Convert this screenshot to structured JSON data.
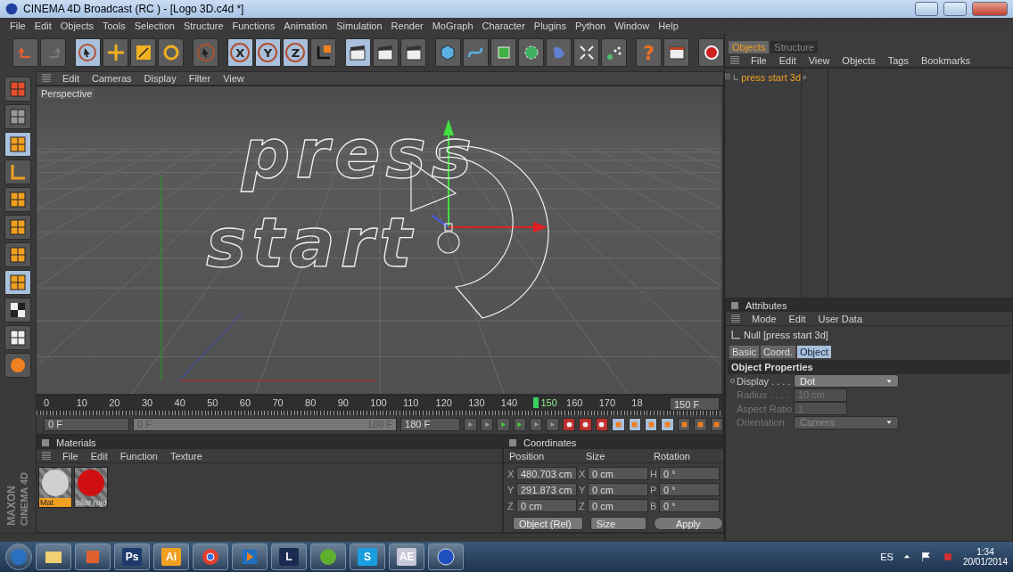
{
  "window": {
    "title": "CINEMA 4D Broadcast (RC ) - [Logo 3D.c4d *]"
  },
  "menu": [
    "File",
    "Edit",
    "Objects",
    "Tools",
    "Selection",
    "Structure",
    "Functions",
    "Animation",
    "Simulation",
    "Render",
    "MoGraph",
    "Character",
    "Plugins",
    "Python",
    "Window",
    "Help"
  ],
  "toolbar": [
    {
      "kind": "undo",
      "selected": false
    },
    {
      "kind": "redo",
      "selected": false
    },
    {
      "kind": "cursor",
      "selected": true
    },
    {
      "kind": "move",
      "selected": false
    },
    {
      "kind": "scale",
      "selected": false
    },
    {
      "kind": "rotate",
      "selected": false
    },
    {
      "kind": "cursor",
      "selected": false
    },
    {
      "kind": "axis",
      "label": "X",
      "selected": true
    },
    {
      "kind": "axis",
      "label": "Y",
      "selected": true
    },
    {
      "kind": "axis",
      "label": "Z",
      "selected": true
    },
    {
      "kind": "coords",
      "selected": false
    },
    {
      "kind": "clapper",
      "selected": true
    },
    {
      "kind": "clapper",
      "selected": false
    },
    {
      "kind": "clapper",
      "selected": false
    },
    {
      "kind": "cube",
      "selected": false
    },
    {
      "kind": "spline",
      "selected": false
    },
    {
      "kind": "nurbs",
      "selected": false
    },
    {
      "kind": "array",
      "selected": false
    },
    {
      "kind": "deformer",
      "selected": false
    },
    {
      "kind": "scene",
      "selected": false
    },
    {
      "kind": "particles",
      "selected": false
    },
    {
      "kind": "help",
      "label": "?",
      "selected": false
    },
    {
      "kind": "render",
      "selected": false
    },
    {
      "kind": "record",
      "selected": false
    }
  ],
  "side_tools": [
    {
      "kind": "layout",
      "selected": false
    },
    {
      "kind": "sculpt",
      "selected": false
    },
    {
      "kind": "model",
      "selected": true
    },
    {
      "kind": "object-axis",
      "selected": false
    },
    {
      "kind": "points",
      "selected": false
    },
    {
      "kind": "edges",
      "selected": false
    },
    {
      "kind": "polygons",
      "selected": false
    },
    {
      "kind": "uv",
      "selected": true
    },
    {
      "kind": "checker",
      "selected": false
    },
    {
      "kind": "workplane",
      "selected": false
    },
    {
      "kind": "snap",
      "selected": false
    }
  ],
  "viewport": {
    "menu": [
      "Edit",
      "Cameras",
      "Display",
      "Filter",
      "View"
    ],
    "camera": "Perspective",
    "logo_lines": [
      "press",
      "start"
    ]
  },
  "timeline": {
    "ticks": [
      {
        "label": "0",
        "selected": false
      },
      {
        "label": "10",
        "selected": false
      },
      {
        "label": "20",
        "selected": false
      },
      {
        "label": "30",
        "selected": false
      },
      {
        "label": "40",
        "selected": false
      },
      {
        "label": "50",
        "selected": false
      },
      {
        "label": "60",
        "selected": false
      },
      {
        "label": "70",
        "selected": false
      },
      {
        "label": "80",
        "selected": false
      },
      {
        "label": "90",
        "selected": false
      },
      {
        "label": "100",
        "selected": false
      },
      {
        "label": "110",
        "selected": false
      },
      {
        "label": "120",
        "selected": false
      },
      {
        "label": "130",
        "selected": false
      },
      {
        "label": "140",
        "selected": false
      },
      {
        "label": "150",
        "selected": true
      },
      {
        "label": "160",
        "selected": false
      },
      {
        "label": "170",
        "selected": false
      },
      {
        "label": "18",
        "selected": false
      }
    ],
    "current_frame": "150 F",
    "start": "0 F",
    "range": {
      "level": 1
    },
    "range_start": "0 F",
    "range_end": "180 F",
    "end": "180 F"
  },
  "objects": {
    "tabs": [
      {
        "label": "Objects",
        "selected": true
      },
      {
        "label": "Structure",
        "selected": false
      }
    ],
    "menu": [
      "File",
      "Edit",
      "View",
      "Objects",
      "Tags",
      "Bookmarks"
    ],
    "items": [
      {
        "name": "press start 3d",
        "expanded": false
      }
    ]
  },
  "attributes": {
    "title": "Attributes",
    "menu": [
      "Mode",
      "Edit",
      "User Data"
    ],
    "object": "Null [press start 3d]",
    "tabs": [
      {
        "label": "Basic",
        "selected": false
      },
      {
        "label": "Coord.",
        "selected": false
      },
      {
        "label": "Object",
        "selected": true
      }
    ],
    "section": "Object Properties",
    "fields": [
      {
        "label": "Display . . . .",
        "value": "Dot",
        "kind": "dropdown",
        "disabled": false
      },
      {
        "label": "Radius . . . .",
        "value": "10 cm",
        "kind": "spinner",
        "disabled": true
      },
      {
        "label": "Aspect Ratio",
        "value": "1",
        "kind": "spinner",
        "disabled": true
      },
      {
        "label": "Orientation",
        "value": "Camera",
        "kind": "dropdown",
        "disabled": true
      }
    ]
  },
  "materials": {
    "title": "Materials",
    "menu": [
      "File",
      "Edit",
      "Function",
      "Texture"
    ],
    "items": [
      {
        "name": "Mat",
        "selected": true,
        "color": "#d0d0d0"
      },
      {
        "name": "pilar rojo",
        "selected": false,
        "color": "#d01010"
      }
    ]
  },
  "coordinates": {
    "title": "Coordinates",
    "headers": [
      "Position",
      "Size",
      "Rotation"
    ],
    "rows": [
      {
        "axis": "X",
        "position": "480.703 cm",
        "size_axis": "X",
        "size": "0 cm",
        "rotation_axis": "H",
        "rotation": "0 °"
      },
      {
        "axis": "Y",
        "position": "291.873 cm",
        "size_axis": "Y",
        "size": "0 cm",
        "rotation_axis": "P",
        "rotation": "0 °"
      },
      {
        "axis": "Z",
        "position": "0 cm",
        "size_axis": "Z",
        "size": "0 cm",
        "rotation_axis": "B",
        "rotation": "0 °"
      }
    ],
    "space": "Object (Rel)",
    "mode": "Size",
    "apply": "Apply"
  },
  "brand": [
    "MAXON",
    "CINEMA 4D"
  ],
  "taskbar": {
    "apps": [
      {
        "kind": "explorer"
      },
      {
        "kind": "package"
      },
      {
        "kind": "badge",
        "label": "Ps",
        "color": "#1e3a6a"
      },
      {
        "kind": "badge",
        "label": "Ai",
        "color": "#f0a020"
      },
      {
        "kind": "browser"
      },
      {
        "kind": "media"
      },
      {
        "kind": "badge",
        "label": "L",
        "color": "#1a2a50"
      },
      {
        "kind": "torrent"
      },
      {
        "kind": "badge",
        "label": "S",
        "color": "#1a9ee0"
      },
      {
        "kind": "badge",
        "label": "AE",
        "color": "#c8c8d8"
      },
      {
        "kind": "globe"
      }
    ],
    "language": "ES",
    "time": "1:34",
    "date": "20/01/2014"
  }
}
